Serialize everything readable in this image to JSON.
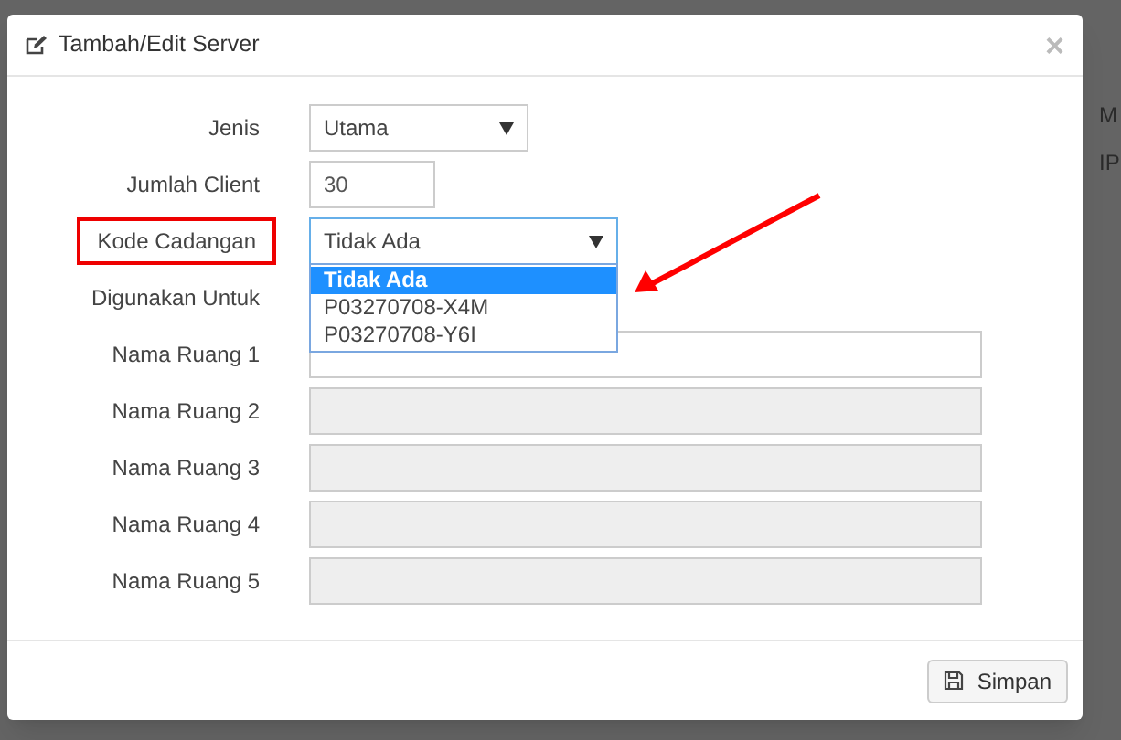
{
  "backdrop_texts": [
    "M",
    "IP"
  ],
  "dialog": {
    "title": "Tambah/Edit Server",
    "close": "×"
  },
  "fields": [
    {
      "kind": "select",
      "label": "Jenis",
      "value": "Utama",
      "highlighted": false,
      "focused": false
    },
    {
      "kind": "text",
      "label": "Jumlah Client",
      "value": "30",
      "highlighted": false,
      "disabled": false
    },
    {
      "kind": "select",
      "label": "Kode Cadangan",
      "value": "Tidak Ada",
      "highlighted": true,
      "focused": true,
      "options": [
        {
          "label": "Tidak Ada",
          "selected": true
        },
        {
          "label": "P03270708-X4M",
          "selected": false
        },
        {
          "label": "P03270708-Y6I",
          "selected": false
        }
      ]
    },
    {
      "kind": "hidden",
      "label": "Digunakan Untuk",
      "highlighted": false
    },
    {
      "kind": "wide",
      "label": "Nama Ruang 1",
      "highlighted": false,
      "disabled": false
    },
    {
      "kind": "wide",
      "label": "Nama Ruang 2",
      "highlighted": false,
      "disabled": true
    },
    {
      "kind": "wide",
      "label": "Nama Ruang 3",
      "highlighted": false,
      "disabled": true
    },
    {
      "kind": "wide",
      "label": "Nama Ruang 4",
      "highlighted": false,
      "disabled": true
    },
    {
      "kind": "wide",
      "label": "Nama Ruang 5",
      "highlighted": false,
      "disabled": true
    }
  ],
  "save_button": "Simpan"
}
